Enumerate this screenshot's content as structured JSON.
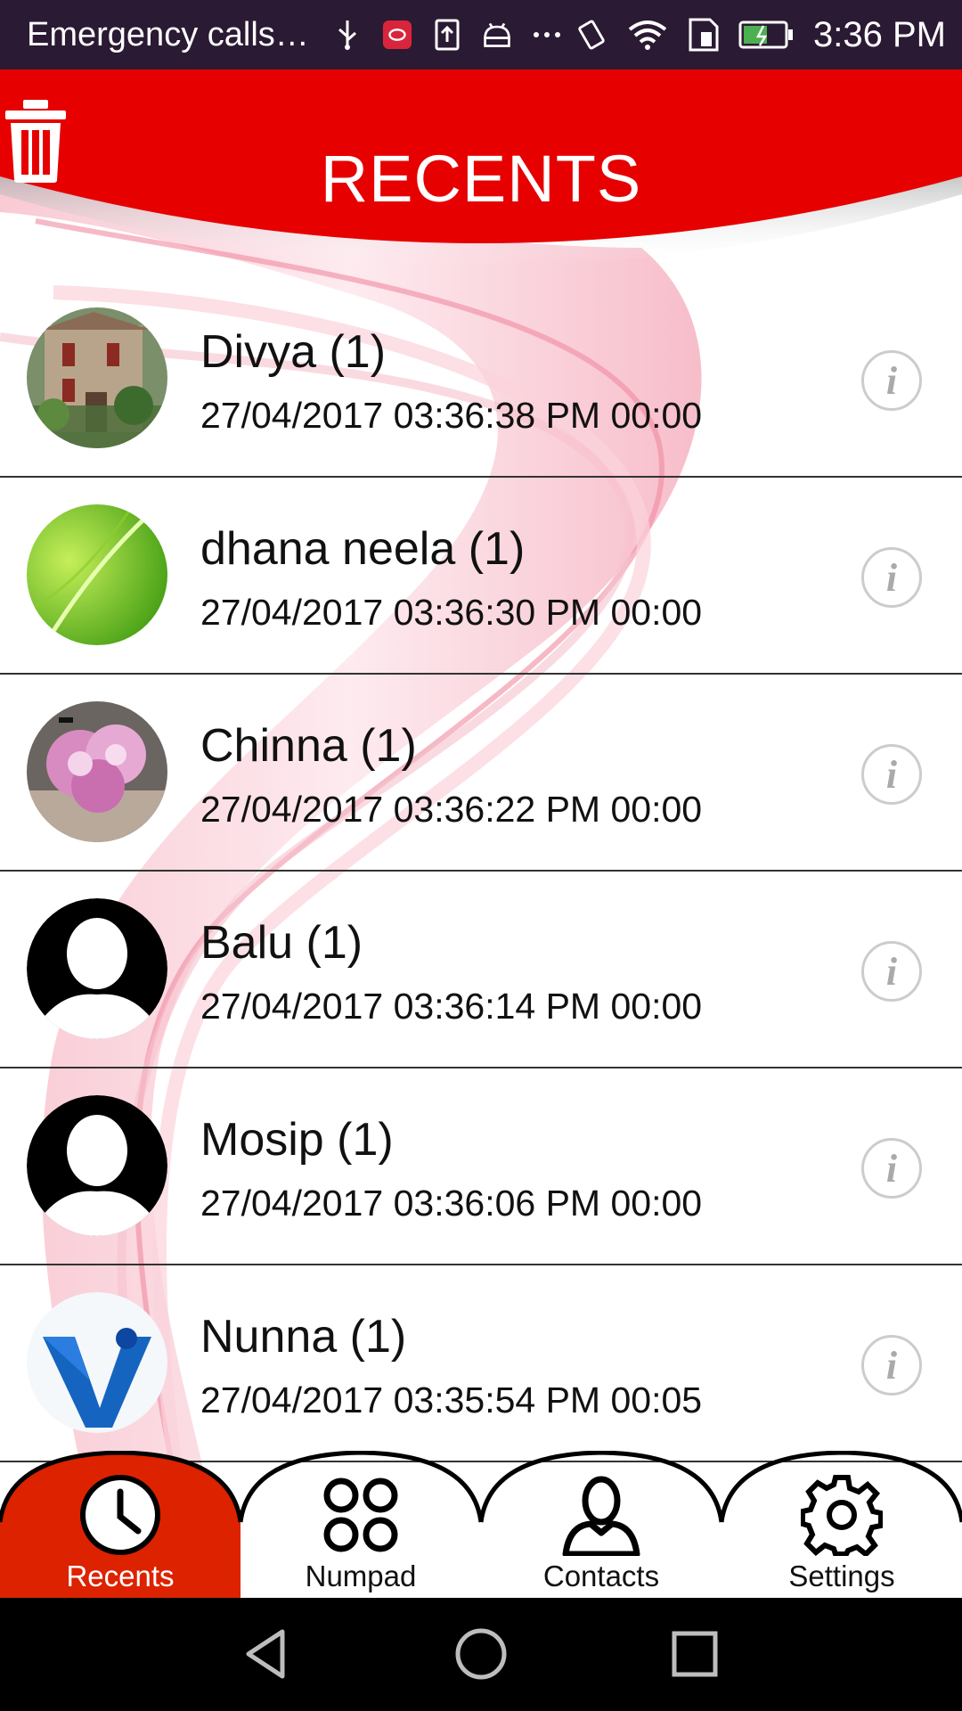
{
  "status_bar": {
    "notification_text": "Emergency calls…",
    "time": "3:36 PM",
    "icons": [
      "usb-icon",
      "app-notification-icon",
      "upload-icon",
      "android-icon",
      "more-icon",
      "vibrate-icon",
      "wifi-icon",
      "sim-icon",
      "battery-icon"
    ]
  },
  "header": {
    "title": "RECENTS",
    "delete_icon": "trash-icon",
    "color": "#e60000"
  },
  "recents": [
    {
      "name": "Divya (1)",
      "datetime": "27/04/2017 03:36:38 PM 00:00",
      "avatar": "house-photo"
    },
    {
      "name": "dhana neela (1)",
      "datetime": "27/04/2017 03:36:30 PM 00:00",
      "avatar": "leaf-photo"
    },
    {
      "name": "Chinna (1)",
      "datetime": "27/04/2017 03:36:22 PM 00:00",
      "avatar": "flowers-photo"
    },
    {
      "name": "Balu (1)",
      "datetime": "27/04/2017 03:36:14 PM 00:00",
      "avatar": "default-person"
    },
    {
      "name": "Mosip (1)",
      "datetime": "27/04/2017 03:36:06 PM 00:00",
      "avatar": "default-person"
    },
    {
      "name": "Nunna (1)",
      "datetime": "27/04/2017 03:35:54 PM 00:05",
      "avatar": "v-logo"
    }
  ],
  "info_icon": "i",
  "bottom_nav": {
    "active": "Recents",
    "active_color": "#dd2200",
    "tabs": [
      {
        "label": "Recents",
        "icon": "clock-icon"
      },
      {
        "label": "Numpad",
        "icon": "numpad-icon"
      },
      {
        "label": "Contacts",
        "icon": "person-icon"
      },
      {
        "label": "Settings",
        "icon": "gear-icon"
      }
    ]
  },
  "system_nav": [
    "back-icon",
    "home-icon",
    "recents-square-icon"
  ]
}
